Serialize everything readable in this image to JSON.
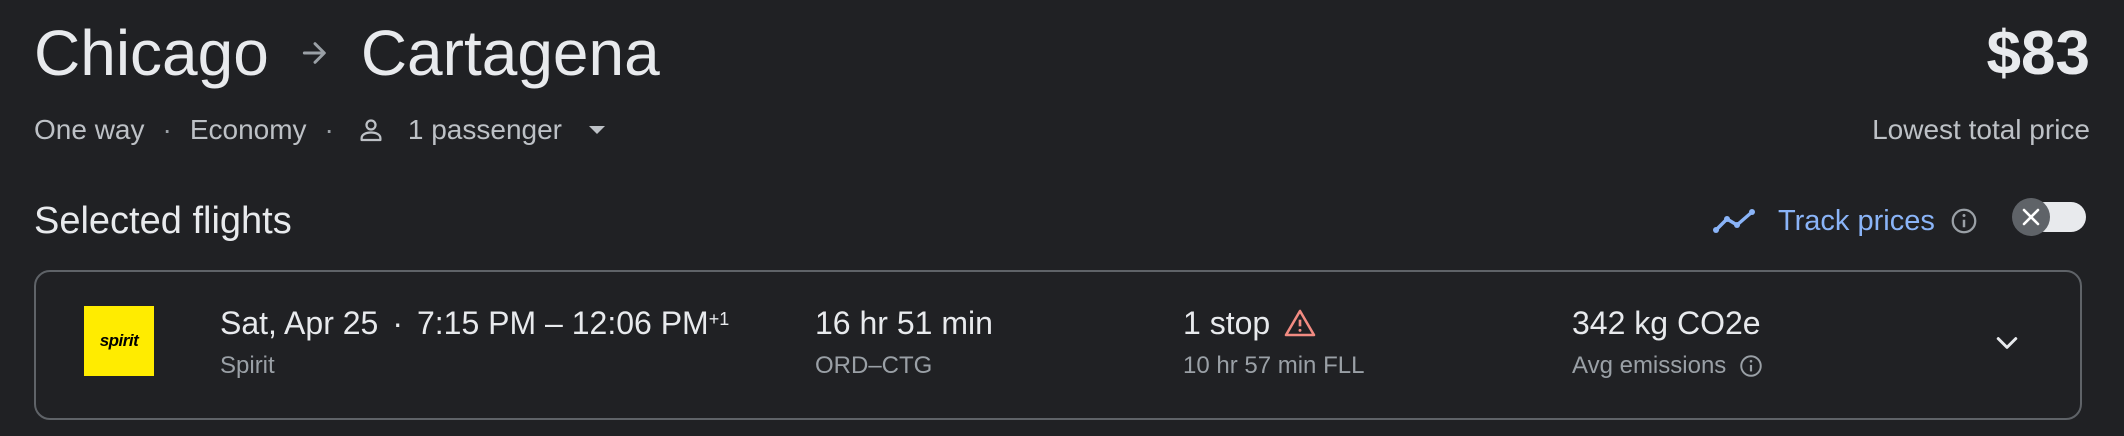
{
  "header": {
    "origin": "Chicago",
    "destination": "Cartagena",
    "price": "$83",
    "price_caption": "Lowest total price",
    "trip_type": "One way",
    "cabin_class": "Economy",
    "passengers": "1 passenger",
    "separator": "·"
  },
  "selected": {
    "title": "Selected flights",
    "track_label": "Track prices",
    "track_enabled": false
  },
  "flight": {
    "airline": "Spirit",
    "logo_text": "spirit",
    "logo_color": "#ffec00",
    "date": "Sat, Apr 25",
    "separator": "·",
    "times": "7:15 PM – 12:06 PM",
    "day_offset": "+1",
    "duration": "16 hr 51 min",
    "route": "ORD–CTG",
    "stops": "1 stop",
    "layover": "10 hr 57 min FLL",
    "emissions": "342 kg CO2e",
    "emissions_label": "Avg emissions"
  },
  "icons": {
    "route_arrow": "arrow-right-icon",
    "passenger": "person-icon",
    "dropdown": "caret-down-icon",
    "trend": "trending-icon",
    "info": "info-icon",
    "toggle_knob": "close-icon",
    "warning": "warning-icon",
    "expand": "chevron-down-icon"
  },
  "colors": {
    "background": "#202124",
    "accent": "#8ab4f8",
    "warning": "#f28b82",
    "border": "#5f6368"
  }
}
